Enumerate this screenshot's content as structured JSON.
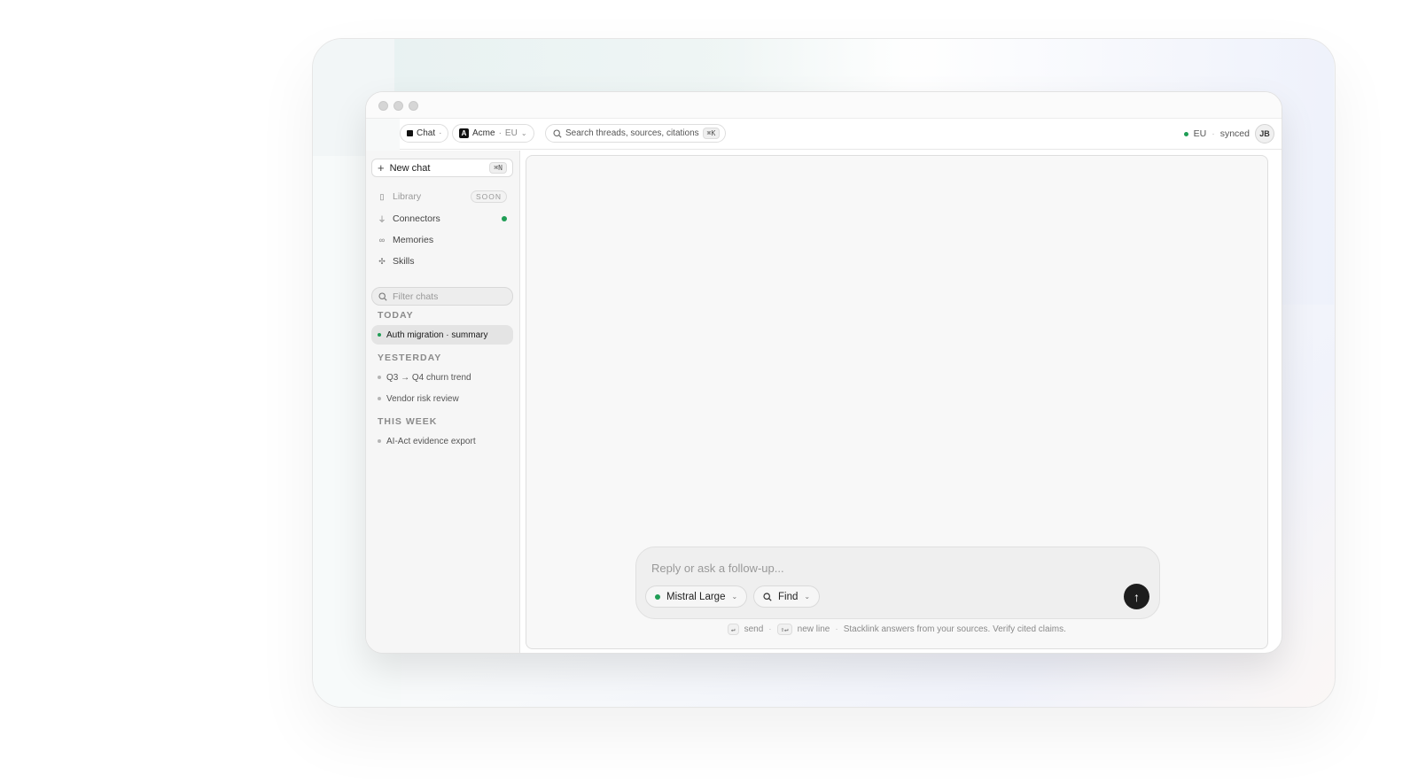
{
  "toolbar": {
    "chat_tab": "Chat",
    "chat_tab_icon": "·",
    "workspace": "Acme",
    "workspace_sep": "·",
    "region_tag": "EU",
    "search_placeholder": "Search threads, sources, citations",
    "search_shortcut": "⌘K",
    "status_region": "EU",
    "status_sep": "·",
    "status_sync": "synced",
    "avatar": "JB"
  },
  "sidebar": {
    "new_chat": "New chat",
    "new_chat_shortcut": "⌘N",
    "nav": [
      {
        "label": "Library",
        "badge": "SOON",
        "icon": "book-icon"
      },
      {
        "label": "Connectors",
        "icon": "plug-icon"
      },
      {
        "label": "Memories",
        "icon": "memory-icon"
      },
      {
        "label": "Skills",
        "icon": "sparkle-icon"
      }
    ],
    "filter_placeholder": "Filter chats",
    "groups": [
      {
        "label": "TODAY",
        "items": [
          "Auth migration · summary"
        ]
      },
      {
        "label": "YESTERDAY",
        "items": [
          "Q3 → Q4 churn trend",
          "Vendor risk review"
        ]
      },
      {
        "label": "THIS WEEK",
        "items": [
          "AI-Act evidence export"
        ]
      }
    ]
  },
  "composer": {
    "placeholder": "Reply or ask a follow-up...",
    "model": "Mistral Large",
    "mode": "Find",
    "hint_send_key": "↵",
    "hint_send": "send",
    "hint_newline_key": "⇧↵",
    "hint_newline": "new line",
    "hint_disclaimer": "Stacklink answers from your sources. Verify cited claims."
  },
  "colors": {
    "accent_green": "#1f9d55",
    "send_button": "#1d1d1d"
  }
}
